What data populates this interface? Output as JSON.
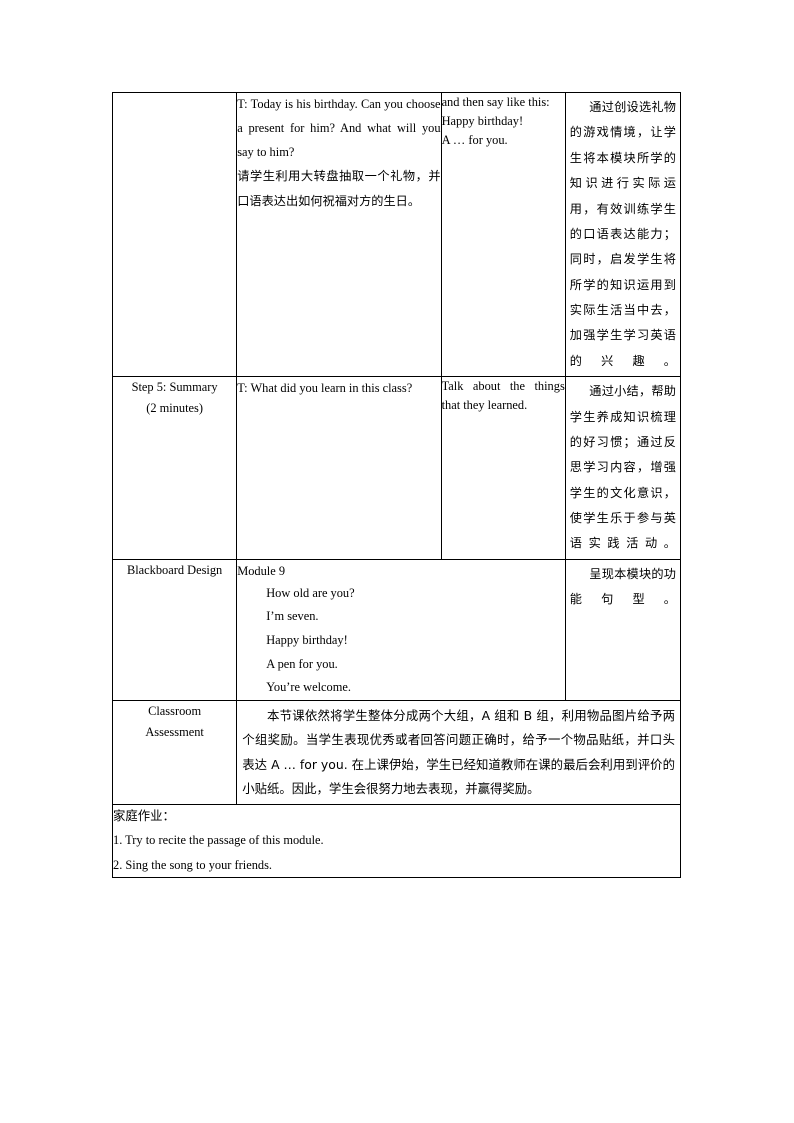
{
  "document": {
    "type": "lesson-plan-table"
  },
  "rows": {
    "activity": {
      "step_label": "",
      "teacher_activity_en": "T: Today is his birthday. Can you choose a present for him? And what will you say to him?",
      "teacher_activity_cn": "请学生利用大转盘抽取一个礼物，并口语表达出如何祝福对方的生日。",
      "student_activity": [
        "and then say like this:",
        "Happy birthday!",
        "A … for you."
      ],
      "design_intent": "通过创设选礼物的游戏情境，让学生将本模块所学的知识进行实际运用，有效训练学生的口语表达能力；同时，启发学生将所学的知识运用到实际生活当中去，加强学生学习英语的兴趣。"
    },
    "summary": {
      "step_label_line1": "Step 5: Summary",
      "step_label_line2": "(2 minutes)",
      "teacher_activity_en": "T: What did you learn in this class?",
      "student_activity": "Talk about the things that they learned.",
      "design_intent": "通过小结，帮助学生养成知识梳理的好习惯；通过反思学习内容，增强学生的文化意识，使学生乐于参与英语实践活动。"
    },
    "blackboard": {
      "label": "Blackboard Design",
      "title": "Module 9",
      "lines": [
        "How old are you?",
        "I’m seven.",
        "Happy birthday!",
        "A pen for you.",
        "You’re welcome."
      ],
      "design_intent": "呈现本模块的功能句型。"
    },
    "assessment": {
      "label_line1": "Classroom",
      "label_line2": "Assessment",
      "body": "本节课依然将学生整体分成两个大组，A 组和 B 组，利用物品图片给予两个组奖励。当学生表现优秀或者回答问题正确时，给予一个物品贴纸，并口头表达 A … for you. 在上课伊始，学生已经知道教师在课的最后会利用到评价的小贴纸。因此，学生会很努力地去表现，并赢得奖励。"
    },
    "homework": {
      "title": "家庭作业：",
      "items": [
        "1. Try to recite the passage of this module.",
        "2. Sing the song to your friends."
      ]
    }
  }
}
